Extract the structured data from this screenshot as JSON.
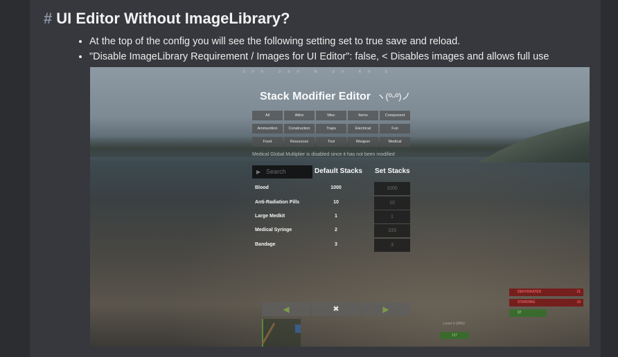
{
  "heading": {
    "hash": "#",
    "title": "UI Editor Without ImageLibrary?"
  },
  "bullets": [
    "At the top of the config you will see the following setting set to true save and reload.",
    "\"Disable ImageLibrary Requirement / Images for UI Editor\": false, < Disables images and allows full use"
  ],
  "game_ui": {
    "compass_text": "300 330 N 30 60 E",
    "title": "Stack Modifier Editor",
    "emoticon": "ヽ(ºᵕº)ノ",
    "categories": [
      [
        "All",
        "Attire",
        "Misc",
        "Items",
        "Component"
      ],
      [
        "Ammunition",
        "Construction",
        "Traps",
        "Electrical",
        "Fun"
      ],
      [
        "Food",
        "Resources",
        "Tool",
        "Weapon",
        "Medical"
      ]
    ],
    "notice": "Medical Global Multiplier is disabled since it has not been modified",
    "search_placeholder": "Search",
    "header_default": "Default Stacks",
    "header_set": "Set Stacks",
    "rows": [
      {
        "name": "Blood",
        "default": "1000",
        "set": "1000"
      },
      {
        "name": "Anti-Radiation Pills",
        "default": "10",
        "set": "10"
      },
      {
        "name": "Large Medkit",
        "default": "1",
        "set": "1"
      },
      {
        "name": "Medical Syringe",
        "default": "2",
        "set": "333"
      },
      {
        "name": "Bandage",
        "default": "3",
        "set": "3"
      }
    ],
    "nav": {
      "prev": "◀",
      "close": "✖",
      "next": "▶"
    },
    "status": [
      {
        "label": "DEHYDRATED",
        "value": "21"
      },
      {
        "label": "STARVING",
        "value": "19"
      }
    ],
    "status_green": "37",
    "hud_text": "Level 4 (38%)",
    "hud_green": "137",
    "colors": {
      "accent_green": "#7c9a4a",
      "status_red": "#e06060"
    }
  }
}
